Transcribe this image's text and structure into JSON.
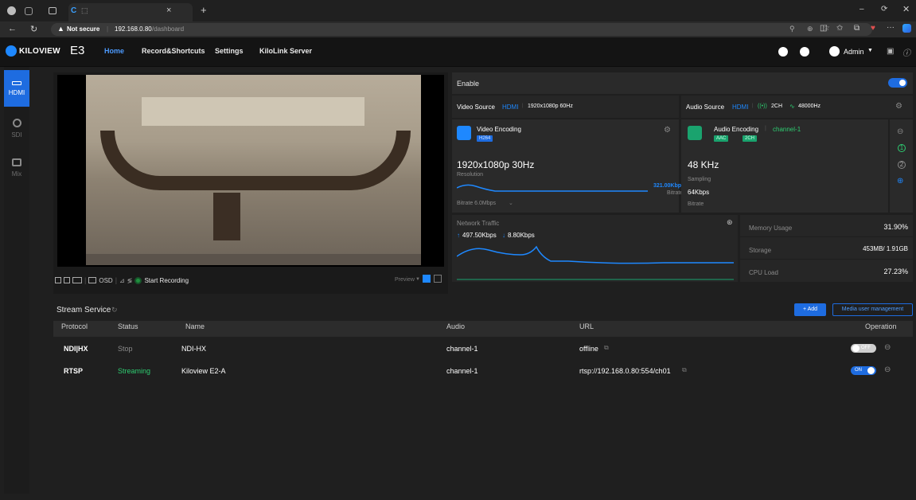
{
  "browser": {
    "tab_icon_label": "⬚",
    "security_label": "Not secure",
    "url_host": "192.168.0.80",
    "url_path": "/dashboard"
  },
  "app": {
    "logo_text": "KILOVIEW",
    "model": "E3",
    "nav": [
      "Home",
      "Record&Shortcuts",
      "Settings",
      "KiloLink Server"
    ],
    "user": "Admin"
  },
  "sidebar": {
    "items": [
      {
        "label": "HDMI",
        "icon": "hdmi-icon"
      },
      {
        "label": "SDI",
        "icon": "sdi-icon"
      },
      {
        "label": "Mix",
        "icon": "mix-icon"
      }
    ]
  },
  "preview": {
    "toolbar": {
      "osd_label": "OSD",
      "record_label": "Start Recording",
      "preview_label": "Preview"
    }
  },
  "encoder": {
    "enable_label": "Enable",
    "enabled": true,
    "video_source_label": "Video Source",
    "video_source_value": "HDMI",
    "video_source_format": "1920x1080p 60Hz",
    "audio_source_label": "Audio Source",
    "audio_source_value": "HDMI",
    "audio_channels": "2CH",
    "audio_rate": "48000Hz",
    "video_encoding_label": "Video Encoding",
    "video_codec": "H264",
    "resolution_value": "1920x1080p 30Hz",
    "resolution_label": "Resolution",
    "bitrate_value": "321.00Kbps",
    "bitrate_label": "Bitrate",
    "bitrate_setting": "Bitrate  6.0Mbps",
    "audio_encoding_label": "Audio Encoding",
    "audio_encoding_channel": "channel-1",
    "audio_codec": "AAC",
    "audio_ch_badge": "2CH",
    "sampling_value": "48 KHz",
    "sampling_label": "Sampling",
    "audio_bitrate_value": "64Kbps",
    "audio_bitrate_label": "Bitrate",
    "side_numbers": [
      "1",
      "2"
    ]
  },
  "network": {
    "title": "Network Traffic",
    "up": "497.50Kbps",
    "down": "8.80Kbps"
  },
  "stats": [
    {
      "label": "Memory Usage",
      "value": "31.90%"
    },
    {
      "label": "Storage",
      "value": "453MB/ 1.91GB"
    },
    {
      "label": "CPU Load",
      "value": "27.23%"
    }
  ],
  "streams": {
    "title": "Stream Service",
    "add_label": "+ Add",
    "media_user_label": "Media user management",
    "headers": [
      "Protocol",
      "Status",
      "Name",
      "Audio",
      "URL",
      "Operation"
    ],
    "rows": [
      {
        "protocol": "NDI|HX",
        "status": "Stop",
        "name": "NDI-HX",
        "audio": "channel-1",
        "url": "offline",
        "toggle": "OFF",
        "on": false
      },
      {
        "protocol": "RTSP",
        "status": "Streaming",
        "name": "Kiloview E2-A",
        "audio": "channel-1",
        "url": "rtsp://192.168.0.80:554/ch01",
        "toggle": "ON",
        "on": true
      }
    ]
  },
  "colors": {
    "accent": "#1e6ce0",
    "streaming": "#2ecc71",
    "stop": "#8a8a8a"
  }
}
